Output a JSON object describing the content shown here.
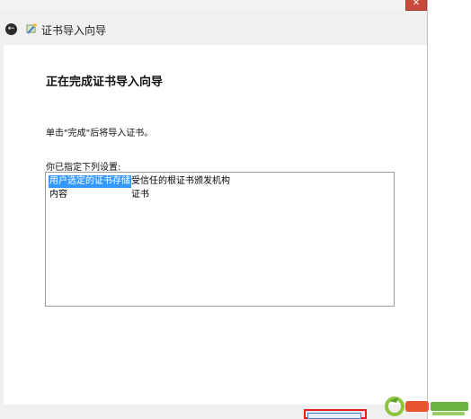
{
  "window": {
    "title": "证书导入向导",
    "close_symbol": "✕",
    "back_symbol": "←"
  },
  "page": {
    "heading": "正在完成证书导入向导",
    "instruction": "单击\"完成\"后将导入证书。",
    "settings_label": "你已指定下列设置:",
    "settings": [
      {
        "key": "用户选定的证书存储",
        "value": "受信任的根证书颁发机构",
        "selected": true
      },
      {
        "key": "内容",
        "value": "证书",
        "selected": false
      }
    ]
  },
  "colors": {
    "selection": "#3399ff",
    "highlight_box": "#e02020",
    "close_button": "#c74a3c"
  },
  "icons": [
    "back-icon",
    "certificate-wizard-icon",
    "close-icon"
  ]
}
